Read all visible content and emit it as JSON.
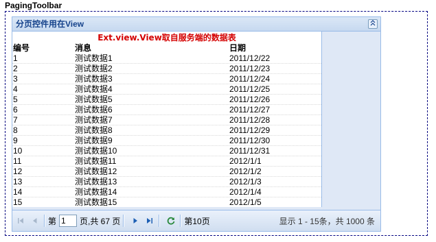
{
  "page": {
    "heading": "PagingToolbar"
  },
  "panel": {
    "title": "分页控件用在View",
    "collapse_icon": "double-chevron-up-icon"
  },
  "view": {
    "title": "Ext.view.View取自服务端的数据表",
    "columns": [
      "编号",
      "消息",
      "日期"
    ],
    "rows": [
      {
        "id": "1",
        "msg": "测试数据1",
        "date": "2011/12/22"
      },
      {
        "id": "2",
        "msg": "测试数据2",
        "date": "2011/12/23"
      },
      {
        "id": "3",
        "msg": "测试数据3",
        "date": "2011/12/24"
      },
      {
        "id": "4",
        "msg": "测试数据4",
        "date": "2011/12/25"
      },
      {
        "id": "5",
        "msg": "测试数据5",
        "date": "2011/12/26"
      },
      {
        "id": "6",
        "msg": "测试数据6",
        "date": "2011/12/27"
      },
      {
        "id": "7",
        "msg": "测试数据7",
        "date": "2011/12/28"
      },
      {
        "id": "8",
        "msg": "测试数据8",
        "date": "2011/12/29"
      },
      {
        "id": "9",
        "msg": "测试数据9",
        "date": "2011/12/30"
      },
      {
        "id": "10",
        "msg": "测试数据10",
        "date": "2011/12/31"
      },
      {
        "id": "11",
        "msg": "测试数据11",
        "date": "2012/1/1"
      },
      {
        "id": "12",
        "msg": "测试数据12",
        "date": "2012/1/2"
      },
      {
        "id": "13",
        "msg": "测试数据13",
        "date": "2012/1/3"
      },
      {
        "id": "14",
        "msg": "测试数据14",
        "date": "2012/1/4"
      },
      {
        "id": "15",
        "msg": "测试数据15",
        "date": "2012/1/5"
      }
    ]
  },
  "toolbar": {
    "page_label": "第",
    "page_value": "1",
    "page_total": "页,共 67 页",
    "current_page": "第10页",
    "display_info": "显示 1 - 15条，共 1000 条"
  }
}
